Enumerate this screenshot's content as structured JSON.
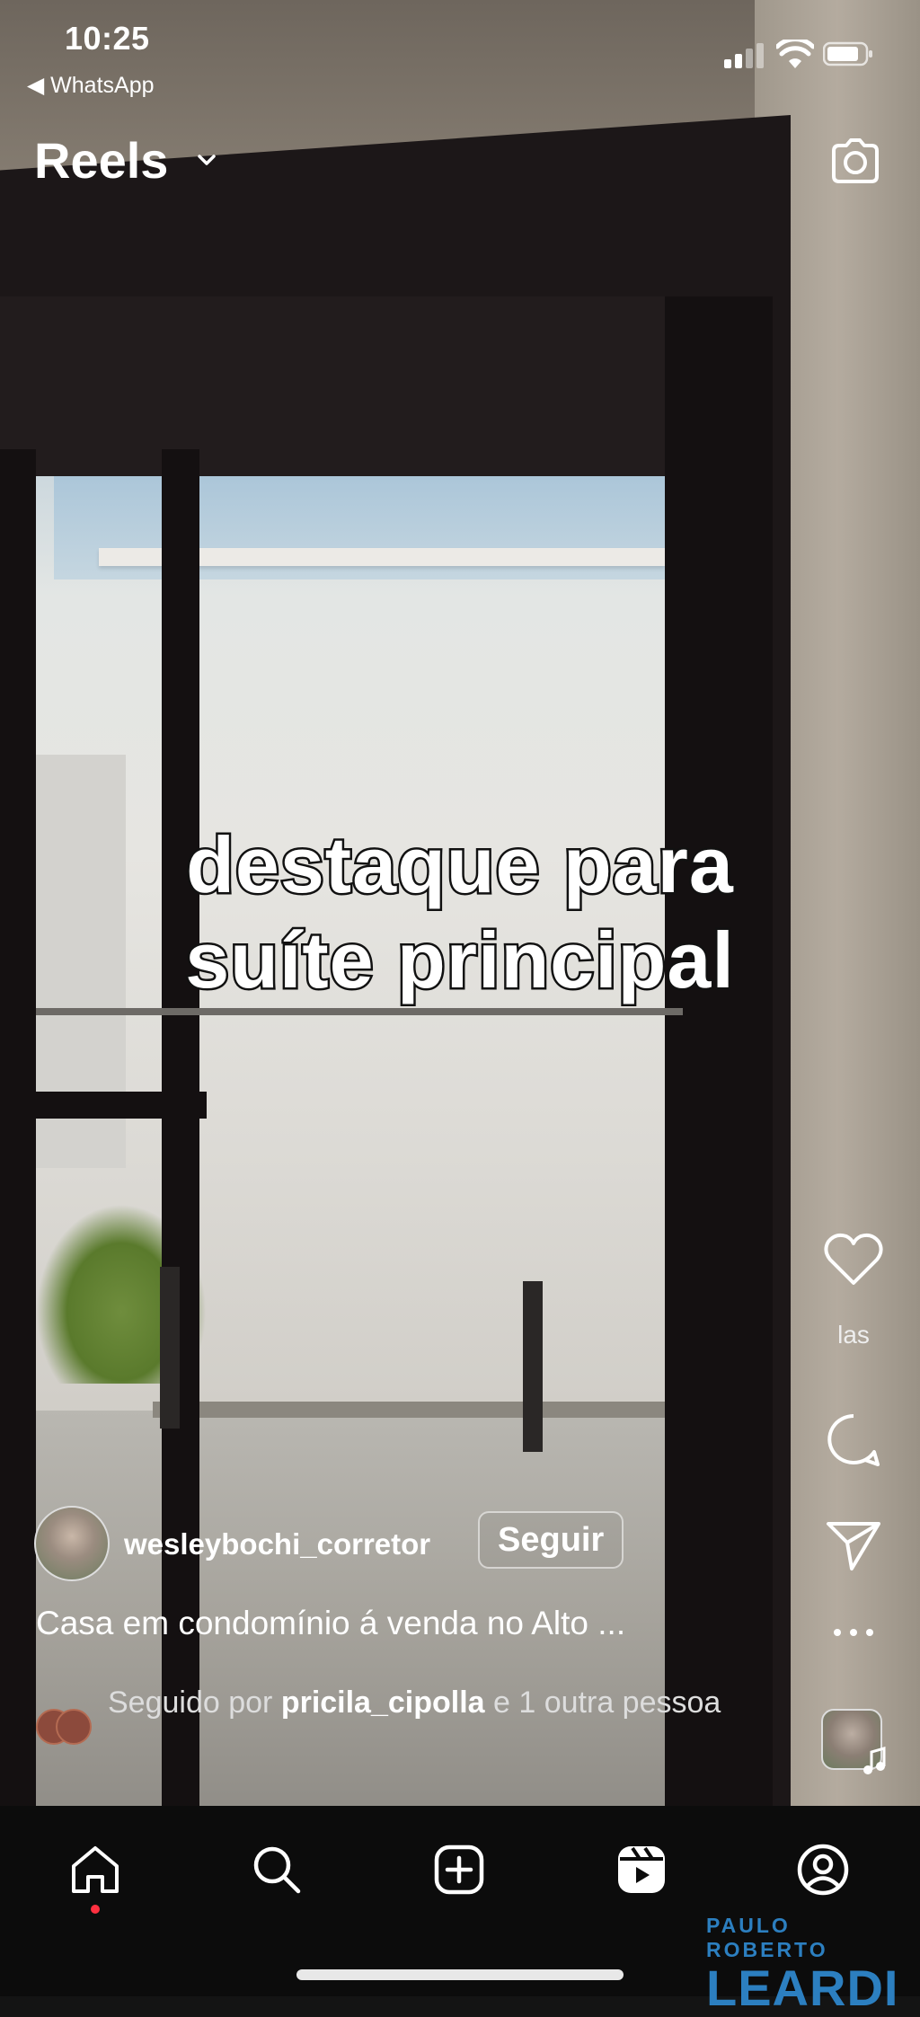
{
  "status_bar": {
    "time": "10:25",
    "back_app": "◀ WhatsApp"
  },
  "header": {
    "title": "Reels"
  },
  "video": {
    "caption_line1": "destaque para",
    "caption_line2": "suíte principal"
  },
  "actions": {
    "likes_label": "las"
  },
  "post": {
    "username": "wesleybochi_corretor",
    "follow_label": "Seguir",
    "description": "Casa em condomínio á venda no Alto ...",
    "followed_prefix": "Seguido por ",
    "followed_user": "pricila_cipolla",
    "followed_suffix": " e 1 outra pessoa"
  },
  "watermark": {
    "line1": "PAULO ROBERTO",
    "line2": "LEARDI"
  },
  "colors": {
    "accent_blue": "#2c7fc0",
    "notification_red": "#ff3040"
  }
}
